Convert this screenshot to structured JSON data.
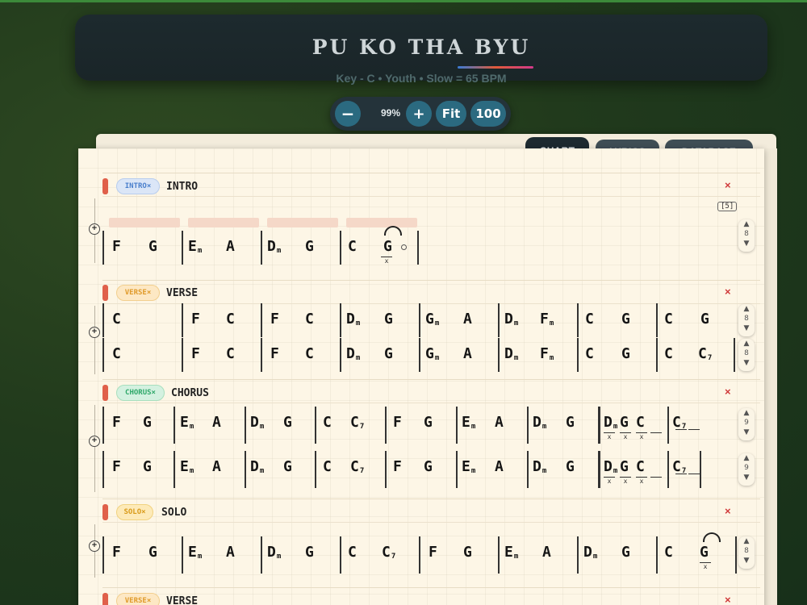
{
  "song": {
    "title": "PU KO THA BYU",
    "subtitle": "Key - C • Youth • Slow = 65 BPM"
  },
  "zoom": {
    "minus_label": "−",
    "level": "99%",
    "plus_label": "+",
    "fit_label": "Fit",
    "hundred_label": "100"
  },
  "tabs": {
    "chart": "CHART",
    "lyrics": "LYRICS",
    "database": "DATABASE"
  },
  "colors": {
    "accent": "#2b6a80",
    "delete": "#d0393a",
    "section_marker": "#e0604a"
  },
  "sections": {
    "intro": {
      "badge": "INTRO×",
      "name": "INTRO",
      "delete": "×",
      "count": "[5]",
      "step": "8"
    },
    "verse": {
      "badge": "VERSE×",
      "name": "VERSE",
      "delete": "×",
      "step": "8"
    },
    "chorus": {
      "badge": "CHORUS×",
      "name": "CHORUS",
      "delete": "×",
      "step": "9"
    },
    "solo": {
      "badge": "SOLO×",
      "name": "SOLO",
      "delete": "×",
      "step": "8"
    },
    "verse2": {
      "badge": "VERSE×",
      "name": "VERSE",
      "delete": "×"
    }
  },
  "chords": {
    "intro": [
      [
        "F",
        "G"
      ],
      [
        "Em",
        "A"
      ],
      [
        "Dm",
        "G"
      ],
      [
        "C",
        "G"
      ]
    ],
    "verse_row1": [
      [
        "C"
      ],
      [
        "F",
        "C"
      ],
      [
        "F",
        "C"
      ],
      [
        "Dm",
        "G"
      ],
      [
        "Gm",
        "A"
      ],
      [
        "Dm",
        "Fm"
      ],
      [
        "C",
        "G"
      ],
      [
        "C",
        "G"
      ]
    ],
    "verse_row2": [
      [
        "C"
      ],
      [
        "F",
        "C"
      ],
      [
        "F",
        "C"
      ],
      [
        "Dm",
        "G"
      ],
      [
        "Gm",
        "A"
      ],
      [
        "Dm",
        "Fm"
      ],
      [
        "C",
        "G"
      ],
      [
        "C",
        "C7"
      ]
    ],
    "chorus_row1": [
      [
        "F",
        "G"
      ],
      [
        "Em",
        "A"
      ],
      [
        "Dm",
        "G"
      ],
      [
        "C",
        "C7"
      ],
      [
        "F",
        "G"
      ],
      [
        "Em",
        "A"
      ],
      [
        "Dm",
        "G"
      ],
      [
        "Dm",
        "G",
        "C"
      ],
      [
        "C7"
      ]
    ],
    "chorus_row2": [
      [
        "F",
        "G"
      ],
      [
        "Em",
        "A"
      ],
      [
        "Dm",
        "G"
      ],
      [
        "C",
        "C7"
      ],
      [
        "F",
        "G"
      ],
      [
        "Em",
        "A"
      ],
      [
        "Dm",
        "G"
      ],
      [
        "Dm",
        "G",
        "C"
      ],
      [
        "C7"
      ]
    ],
    "solo": [
      [
        "F",
        "G"
      ],
      [
        "Em",
        "A"
      ],
      [
        "Dm",
        "G"
      ],
      [
        "C",
        "C7"
      ],
      [
        "F",
        "G"
      ],
      [
        "Em",
        "A"
      ],
      [
        "Dm",
        "G"
      ],
      [
        "C",
        "G"
      ]
    ]
  },
  "stepper_icons": {
    "up": "▲",
    "down": "▼"
  },
  "marks": {
    "x": "x",
    "plus": "+"
  }
}
